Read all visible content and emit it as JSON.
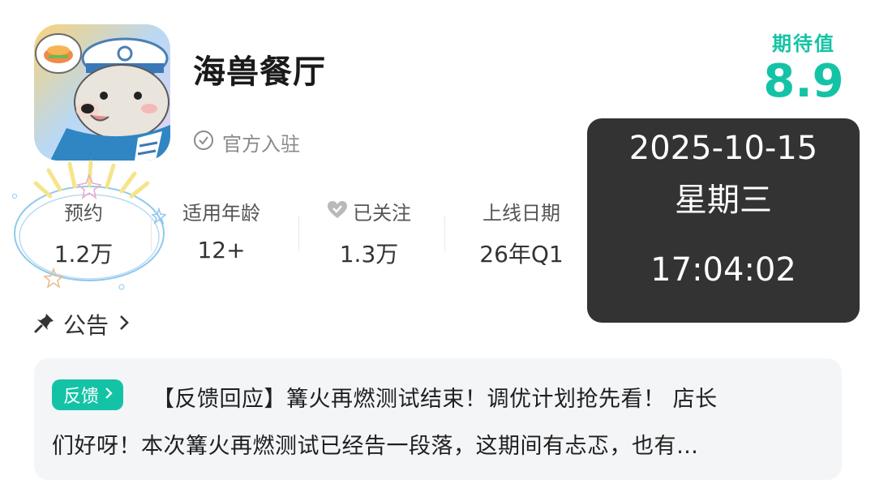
{
  "app": {
    "title": "海兽餐厅",
    "verified_label": "官方入驻",
    "rating_label": "期待值",
    "rating_value": "8.9"
  },
  "stats": [
    {
      "label": "预约",
      "value": "1.2万"
    },
    {
      "label": "适用年龄",
      "value": "12+"
    },
    {
      "label": "已关注",
      "value": "1.3万",
      "icon": "heart-check-icon"
    },
    {
      "label": "上线日期",
      "value": "26年Q1"
    }
  ],
  "clock": {
    "date": "2025-10-15",
    "weekday": "星期三",
    "time": "17:04:02"
  },
  "announcement": {
    "label": "公告",
    "badge": "反馈",
    "line1": "【反馈回应】篝火再燃测试结束！调优计划抢先看！ 店长",
    "line2": "们好呀！本次篝火再燃测试已经告一段落，这期间有忐忑，也有…"
  },
  "colors": {
    "accent": "#14c3a5",
    "overlay": "#333333",
    "card_bg": "#f4f5f7"
  }
}
